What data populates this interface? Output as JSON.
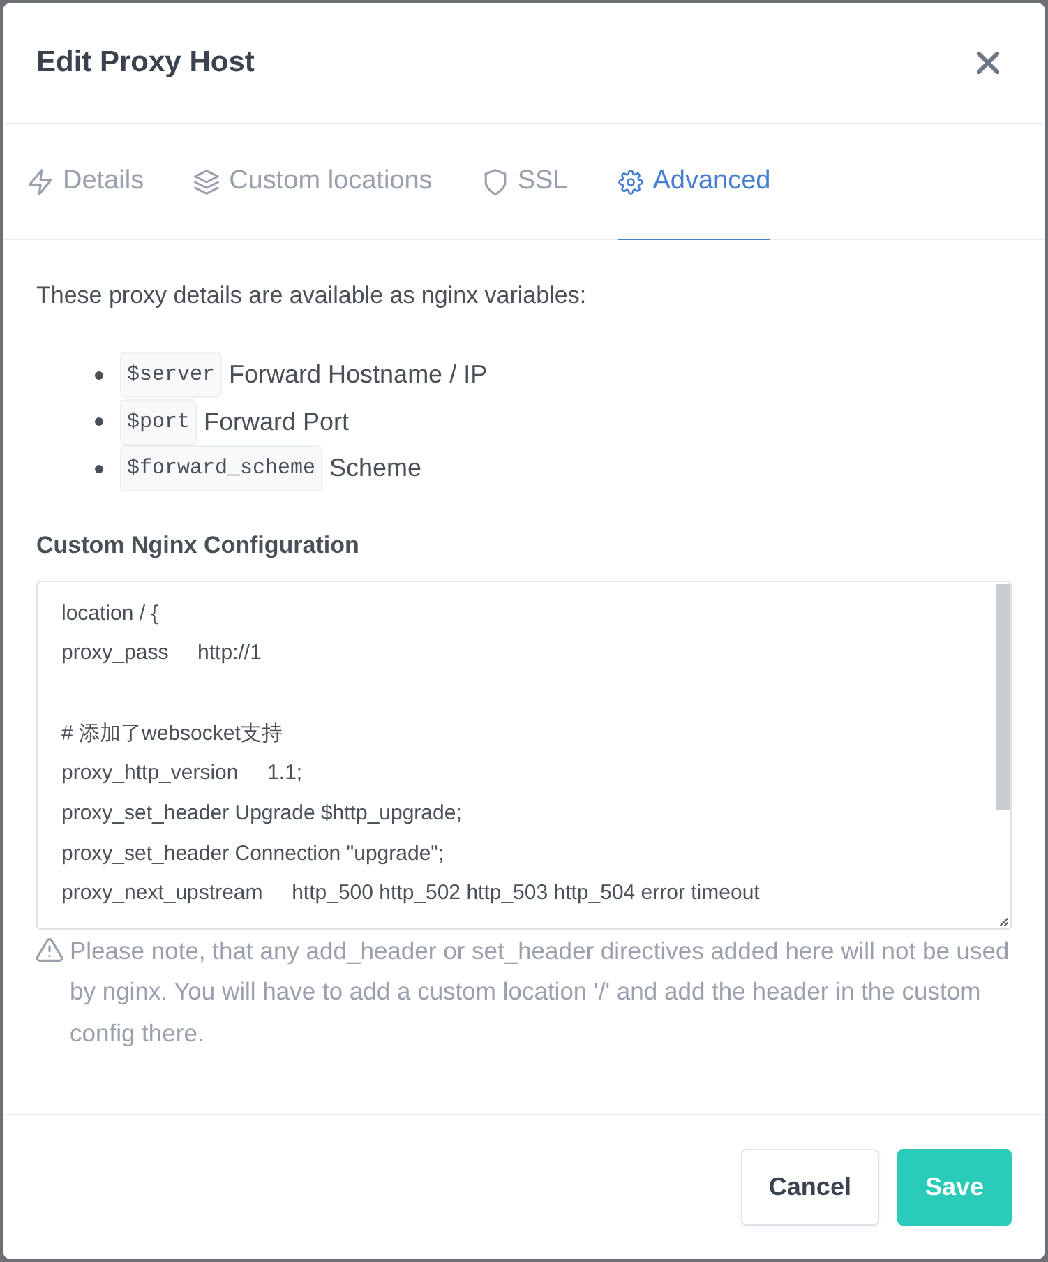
{
  "modal": {
    "title": "Edit Proxy Host"
  },
  "tabs": [
    {
      "label": "Details",
      "selected": false
    },
    {
      "label": "Custom locations",
      "selected": false
    },
    {
      "label": "SSL",
      "selected": false
    },
    {
      "label": "Advanced",
      "selected": true
    }
  ],
  "advanced": {
    "intro": "These proxy details are available as nginx variables:",
    "variables": [
      {
        "code": "$server",
        "description": "Forward Hostname / IP"
      },
      {
        "code": "$port",
        "description": "Forward Port"
      },
      {
        "code": "$forward_scheme",
        "description": "Scheme"
      }
    ],
    "config_label": "Custom Nginx Configuration",
    "config_value": "location / {\nproxy_pass     http://1\n\n# 添加了websocket支持\nproxy_http_version     1.1;\nproxy_set_header Upgrade $http_upgrade;\nproxy_set_header Connection \"upgrade\";\nproxy_next_upstream     http_500 http_502 http_503 http_504 error timeout",
    "note": "Please note, that any add_header or set_header directives added here will not be used by nginx. You will have to add a custom location '/' and add the header in the custom config there."
  },
  "buttons": [
    {
      "label": "Cancel",
      "kind": "secondary"
    },
    {
      "label": "Save",
      "kind": "primary"
    }
  ]
}
